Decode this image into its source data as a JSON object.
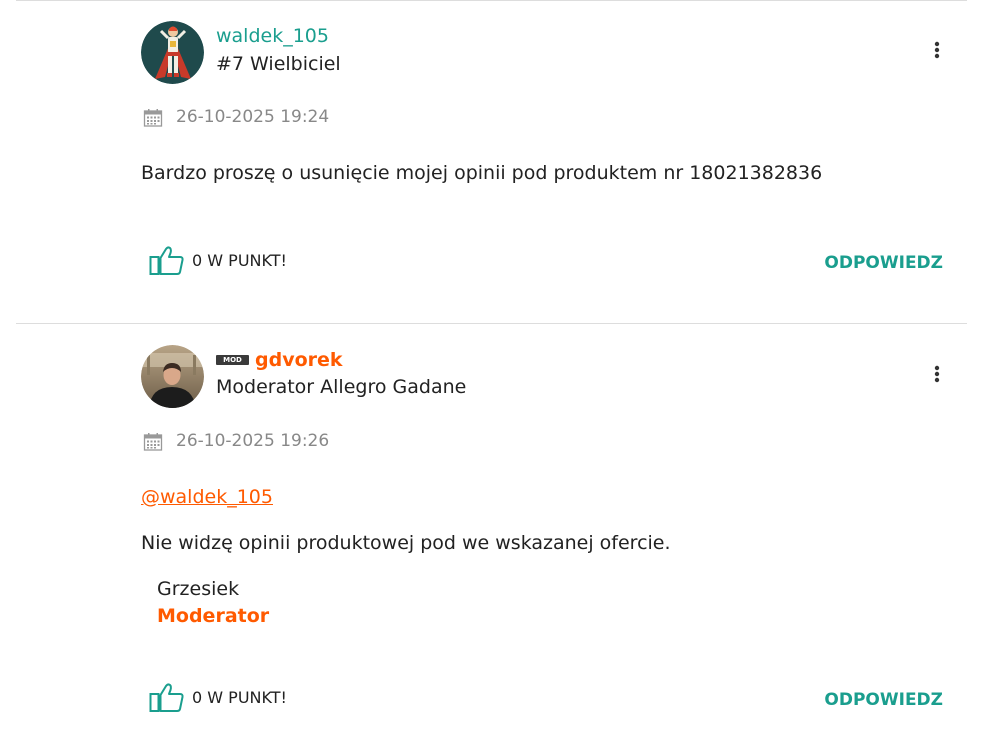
{
  "colors": {
    "accent_teal": "#1a9e8e",
    "accent_orange": "#ff5a00",
    "muted_gray": "#888888",
    "divider": "#dddddd"
  },
  "posts": [
    {
      "author": "waldek_105",
      "rank": "#7 Wielbiciel",
      "avatar_icon": "superhero-avatar",
      "date": "26-10-2025 19:24",
      "body": "Bardzo proszę o usunięcie mojej opinii pod produktem nr 18021382836",
      "like_label": "0 W PUNKT!",
      "reply_label": "ODPOWIEDZ"
    },
    {
      "badge": "MOD",
      "author": "gdvorek",
      "rank": "Moderator Allegro Gadane",
      "avatar_icon": "photo-avatar",
      "date": "26-10-2025 19:26",
      "mention": "@waldek_105",
      "body": "Nie widzę opinii produktowej pod we wskazanej ofercie.",
      "signature_name": "Grzesiek",
      "signature_role": "Moderator",
      "like_label": "0 W PUNKT!",
      "reply_label": "ODPOWIEDZ"
    }
  ]
}
